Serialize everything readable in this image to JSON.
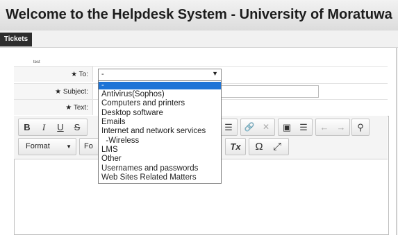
{
  "header": {
    "title": "Welcome to the Helpdesk System - University of Moratuwa"
  },
  "tabs": [
    {
      "label": "Tickets"
    }
  ],
  "breadcrumb": "test",
  "form": {
    "to_label": "★ To:",
    "subject_label": "★ Subject:",
    "text_label": "★ Text:",
    "to_value": "-",
    "to_options": [
      "-",
      "Antivirus(Sophos)",
      "Computers and printers",
      "Desktop software",
      "Emails",
      "Internet and network services",
      "  -Wireless",
      "LMS",
      "Other",
      "Usernames and passwords",
      "Web Sites Related Matters"
    ]
  },
  "toolbar": {
    "bold": "B",
    "italic": "I",
    "underline": "U",
    "strike": "S",
    "format_label": "Format",
    "font_label": "Fo",
    "remove_format": "Tx",
    "special_char": "Ω",
    "maximize": "⤢"
  }
}
